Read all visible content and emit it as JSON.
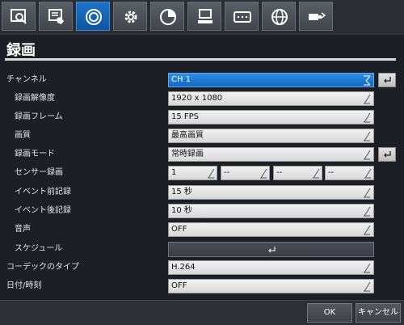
{
  "toolbar": {
    "tabs": [
      {
        "icon": "search-monitor-icon"
      },
      {
        "icon": "playback-hand-icon"
      },
      {
        "icon": "record-icon",
        "active": true
      },
      {
        "icon": "gear-icon"
      },
      {
        "icon": "pie-chart-icon"
      },
      {
        "icon": "system-terminal-icon"
      },
      {
        "icon": "keyboard-icon"
      },
      {
        "icon": "network-globe-icon"
      },
      {
        "icon": "usb-backup-icon"
      }
    ]
  },
  "page": {
    "title": "録画"
  },
  "settings": {
    "channel": {
      "label": "チャンネル",
      "value": "CH 1"
    },
    "resolution": {
      "label": "録画解像度",
      "value": "1920 x 1080"
    },
    "frame_rate": {
      "label": "録画フレーム",
      "value": "15 FPS"
    },
    "quality": {
      "label": "画質",
      "value": "最高画質"
    },
    "mode": {
      "label": "録画モード",
      "value": "常時録画"
    },
    "sensor": {
      "label": "センサー録画",
      "values": [
        "1",
        "--",
        "--",
        "--"
      ]
    },
    "pre_event": {
      "label": "イベント前記録",
      "value": "15 秒"
    },
    "post_event": {
      "label": "イベント後記録",
      "value": "10 秒"
    },
    "audio": {
      "label": "音声",
      "value": "OFF"
    },
    "schedule": {
      "label": "スケジュール"
    },
    "codec": {
      "label": "コーデックのタイプ",
      "value": "H.264"
    },
    "datetime": {
      "label": "日付/時刻",
      "value": "OFF"
    }
  },
  "buttons": {
    "ok": "OK",
    "cancel": "キャンセル"
  },
  "colors": {
    "accent": "#1367c2",
    "background": "#1c1f26"
  }
}
